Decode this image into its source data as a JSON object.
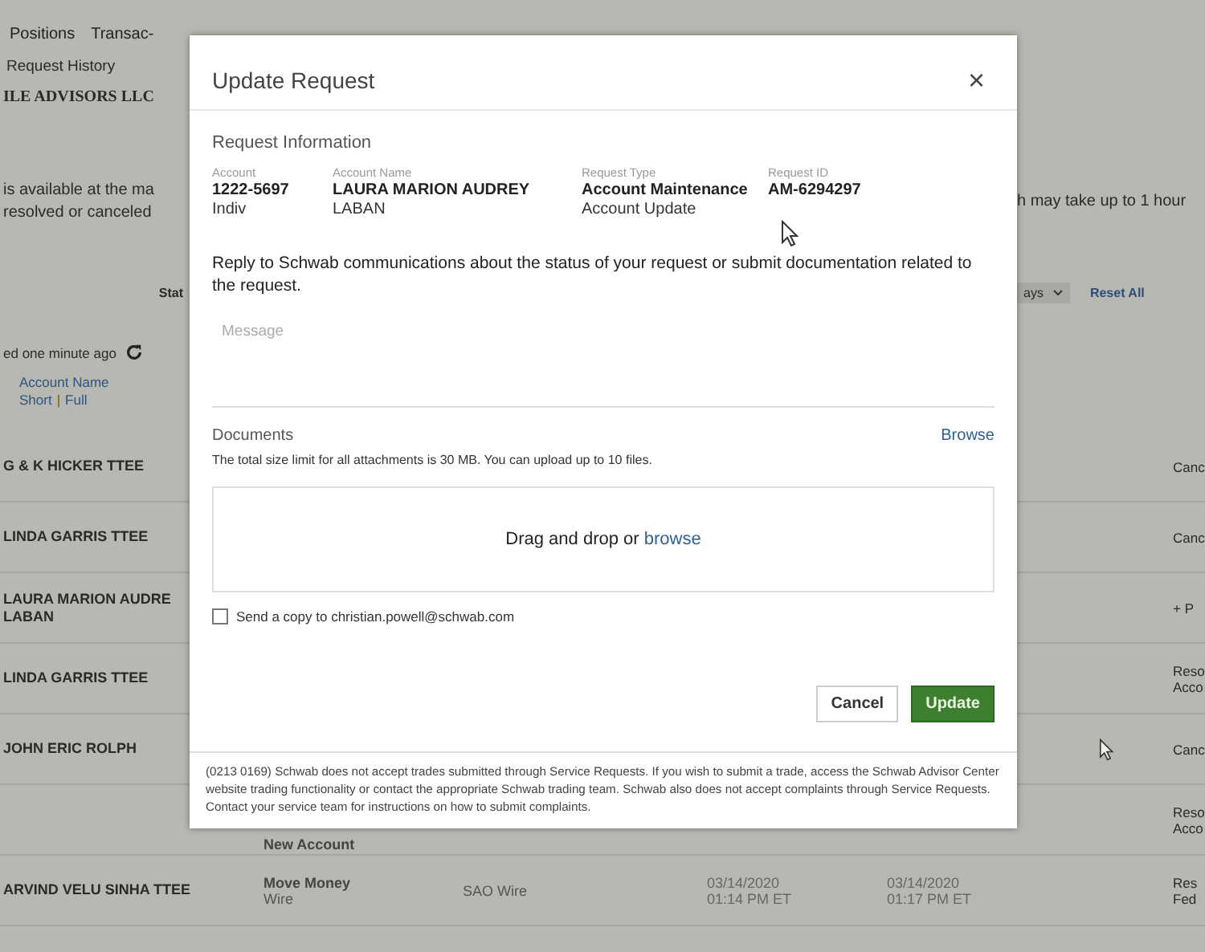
{
  "background": {
    "nav": [
      {
        "label": "Positions",
        "selected": false
      },
      {
        "label": "Transac-",
        "selected": false
      }
    ],
    "breadcrumb": "Request History",
    "firm": "ILE ADVISORS LLC",
    "notice_left": [
      "is available at the ma",
      "resolved or canceled"
    ],
    "notice_right": "h may take up to 1 hour",
    "status_label": "Stat",
    "days_filter": "ays",
    "reset_link": "Reset All",
    "updated": "ed one minute ago",
    "column_header": "Account Name",
    "name_toggle": [
      "Short",
      "Full"
    ],
    "toggle_separator": "|",
    "rows": [
      {
        "name": "G & K HICKER TTEE",
        "type": [],
        "channel": "",
        "date_1": [],
        "date_2": [],
        "status": [
          "Canc"
        ]
      },
      {
        "name": "LINDA GARRIS TTEE",
        "type": [],
        "channel": "",
        "date_1": [],
        "date_2": [],
        "status": [
          "Canc"
        ]
      },
      {
        "name": "LAURA MARION AUDRE LABAN",
        "type": [],
        "channel": "",
        "date_1": [],
        "date_2": [],
        "status": [
          "+ P"
        ]
      },
      {
        "name": "LINDA GARRIS TTEE",
        "type": [],
        "channel": "",
        "date_1": [],
        "date_2": [],
        "status": [
          "Reso",
          "Acco"
        ]
      },
      {
        "name": "JOHN ERIC ROLPH",
        "type": [],
        "channel": "",
        "date_1": [],
        "date_2": [],
        "status": [
          "Canc"
        ]
      },
      {
        "name": "",
        "type": [
          "New Account"
        ],
        "channel": "",
        "date_1": [],
        "date_2": [],
        "status": [
          "Reso",
          "Acco"
        ]
      },
      {
        "name": "ARVIND VELU SINHA TTEE",
        "type": [
          "Move Money",
          "Wire"
        ],
        "channel": "SAO Wire",
        "date_1": [
          "03/14/2020",
          "01:14 PM ET"
        ],
        "date_2": [
          "03/14/2020",
          "01:17 PM ET"
        ],
        "status": [
          "Res",
          "Fed"
        ]
      }
    ]
  },
  "dialog": {
    "title": "Update Request",
    "close": "×",
    "section": "Request Information",
    "info": [
      {
        "label": "Account",
        "lines": [
          "1222-5697",
          "Indiv"
        ]
      },
      {
        "label": "Account Name",
        "lines": [
          "LAURA MARION AUDREY",
          "LABAN"
        ]
      },
      {
        "label": "Request Type",
        "lines": [
          "Account Maintenance",
          "Account Update"
        ]
      },
      {
        "label": "Request ID",
        "lines": [
          "AM-6294297"
        ]
      }
    ],
    "intro": "Reply to Schwab communications about the status of your request or submit documentation related to the request.",
    "message": {
      "label": "Message"
    },
    "documents": {
      "label": "Documents",
      "browse": "Browse",
      "note": "The total size limit for all attachments is 30 MB. You can upload up to 10 files.",
      "drop_text": "Drag and drop or",
      "drop_link": "browse"
    },
    "copy": {
      "label": "Send a copy to christian.powell@schwab.com",
      "checked": false
    },
    "buttons": [
      {
        "label": "Cancel",
        "kind": "secondary"
      },
      {
        "label": "Update",
        "kind": "primary"
      }
    ],
    "disclaimer": "(0213 0169) Schwab does not accept trades submitted through Service Requests. If you wish to submit a trade, access the Schwab Advisor Center website trading functionality or contact the appropriate Schwab trading team. Schwab also does not accept complaints through Service Requests. Contact your service team for instructions on how to submit complaints."
  }
}
